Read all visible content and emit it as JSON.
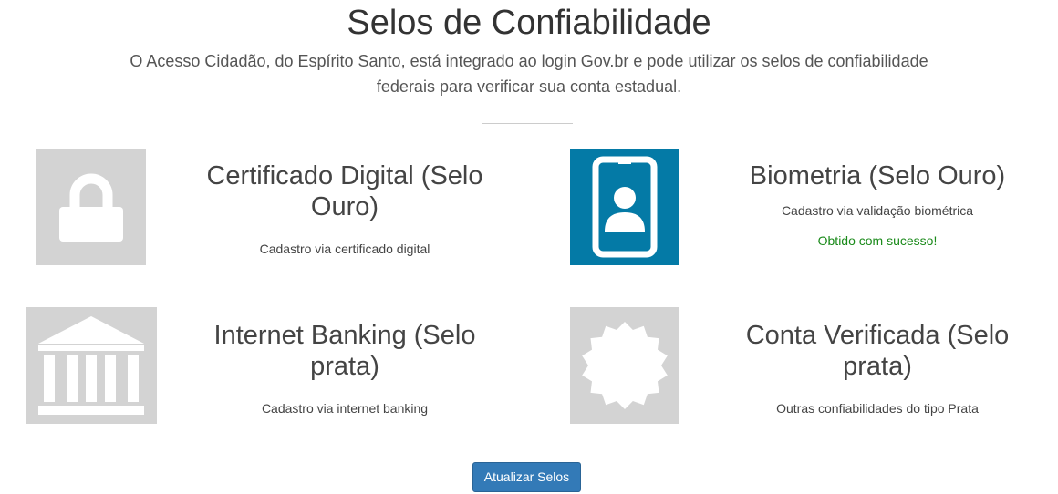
{
  "header": {
    "title": "Selos de Confiabilidade",
    "subtitle": "O Acesso Cidadão, do Espírito Santo, está integrado ao login Gov.br e pode utilizar os selos de confiabilidade federais para verificar sua conta estadual."
  },
  "seals": [
    {
      "icon": "lock-icon",
      "title": "Certificado Digital (Selo Ouro)",
      "description": "Cadastro via certificado digital",
      "status": "",
      "obtained": false
    },
    {
      "icon": "id-badge-icon",
      "title": "Biometria (Selo Ouro)",
      "description": "Cadastro via validação biométrica",
      "status": "Obtido com sucesso!",
      "obtained": true
    },
    {
      "icon": "bank-icon",
      "title": "Internet Banking (Selo prata)",
      "description": "Cadastro via internet banking",
      "status": "",
      "obtained": false
    },
    {
      "icon": "certificate-badge-icon",
      "title": "Conta Verificada (Selo prata)",
      "description": "Outras confiabilidades do tipo Prata",
      "status": "",
      "obtained": false
    }
  ],
  "actions": {
    "update_label": "Atualizar Selos"
  },
  "colors": {
    "icon_inactive": "#d3d3d3",
    "icon_active": "#047aa6",
    "status_success": "#1a8a1a",
    "button_primary": "#337ab7"
  }
}
